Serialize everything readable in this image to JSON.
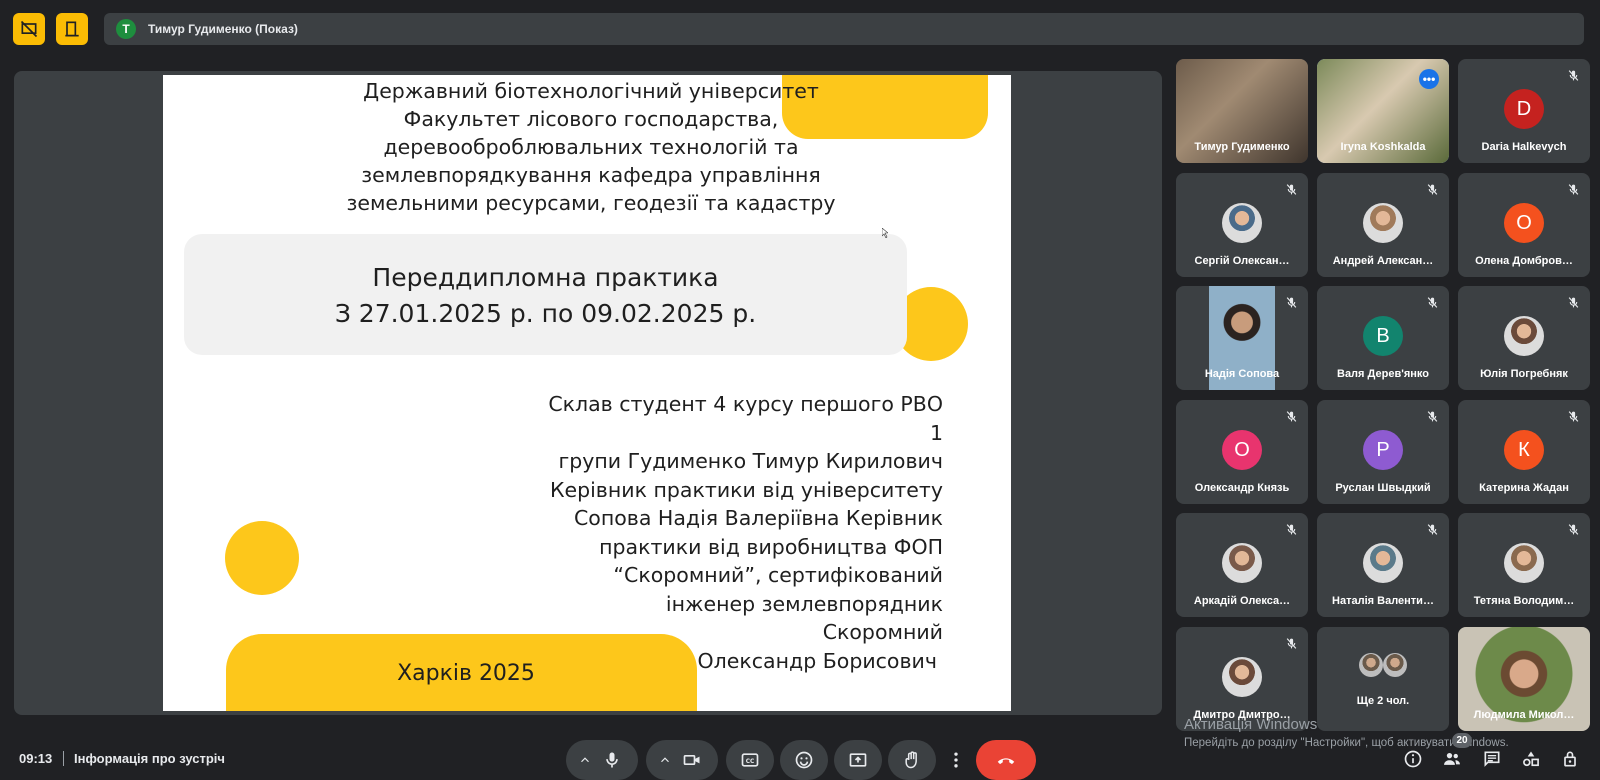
{
  "presenter_bar": {
    "avatar_letter": "Т",
    "label": "Тимур Гудименко (Показ)"
  },
  "slide": {
    "university_lines": [
      "Державний біотехнологічний університет",
      "Факультет лісового господарства,",
      "деревооброблювальних технологій та",
      "землевпорядкування кафедра управління",
      "земельними ресурсами, геодезії та кадастру"
    ],
    "practice_title": "Переддипломна практика",
    "practice_dates": "З 27.01.2025 р. по 09.02.2025 р.",
    "student_lines": [
      "Склав студент 4 курсу першого РВО 1",
      "групи Гудименко Тимур Кирилович",
      "Керівник практики від університету",
      "Сопова Надія Валеріївна Керівник",
      "практики від виробництва ФОП",
      "“Скоромний”, сертифікований",
      "інженер землевпорядник Скоромний",
      "Олександр Борисович"
    ],
    "city_year": "Харків 2025",
    "accent_color": "#fdc71b"
  },
  "participants": [
    {
      "name": "Тимур Гудименко",
      "type": "video",
      "muted": false
    },
    {
      "name": "Iryna Koshkalda",
      "type": "video",
      "muted": false,
      "active": true
    },
    {
      "name": "Daria Halkevych",
      "type": "letter",
      "letter": "D",
      "color": "#c5221f",
      "muted": true
    },
    {
      "name": "Сергій Олексан…",
      "type": "photo",
      "muted": true
    },
    {
      "name": "Андрей Алексан…",
      "type": "photo",
      "muted": true
    },
    {
      "name": "Олена Домбров…",
      "type": "letter",
      "letter": "О",
      "color": "#f4511e",
      "muted": true
    },
    {
      "name": "Надія Сопова",
      "type": "video",
      "muted": true
    },
    {
      "name": "Валя Дерев'янко",
      "type": "letter",
      "letter": "В",
      "color": "#12846e",
      "muted": true
    },
    {
      "name": "Юлія Погребняк",
      "type": "photo",
      "muted": true
    },
    {
      "name": "Олександр Князь",
      "type": "letter",
      "letter": "О",
      "color": "#e8346e",
      "muted": true
    },
    {
      "name": "Руслан Швыдкий",
      "type": "letter",
      "letter": "Р",
      "color": "#8e5bd1",
      "muted": true
    },
    {
      "name": "Катерина Жадан",
      "type": "letter",
      "letter": "К",
      "color": "#f4511e",
      "muted": true
    },
    {
      "name": "Аркадій Олекса…",
      "type": "photo",
      "muted": true
    },
    {
      "name": "Наталія Валенти…",
      "type": "photo",
      "muted": true
    },
    {
      "name": "Тетяна Володим…",
      "type": "photo",
      "muted": true
    },
    {
      "name": "Дмитро Дмитро…",
      "type": "photo",
      "muted": true
    },
    {
      "name": "Ще 2 чол.",
      "type": "more",
      "muted": false
    },
    {
      "name": "Людмила Микол…",
      "type": "video",
      "muted": false
    }
  ],
  "bottom": {
    "time": "09:13",
    "meeting_info": "Інформація про зустріч",
    "people_count": "20",
    "windows_activation_title": "Активація Windows",
    "windows_activation_sub": "Перейдіть до розділу \"Настройки\", щоб активувати Windows."
  }
}
